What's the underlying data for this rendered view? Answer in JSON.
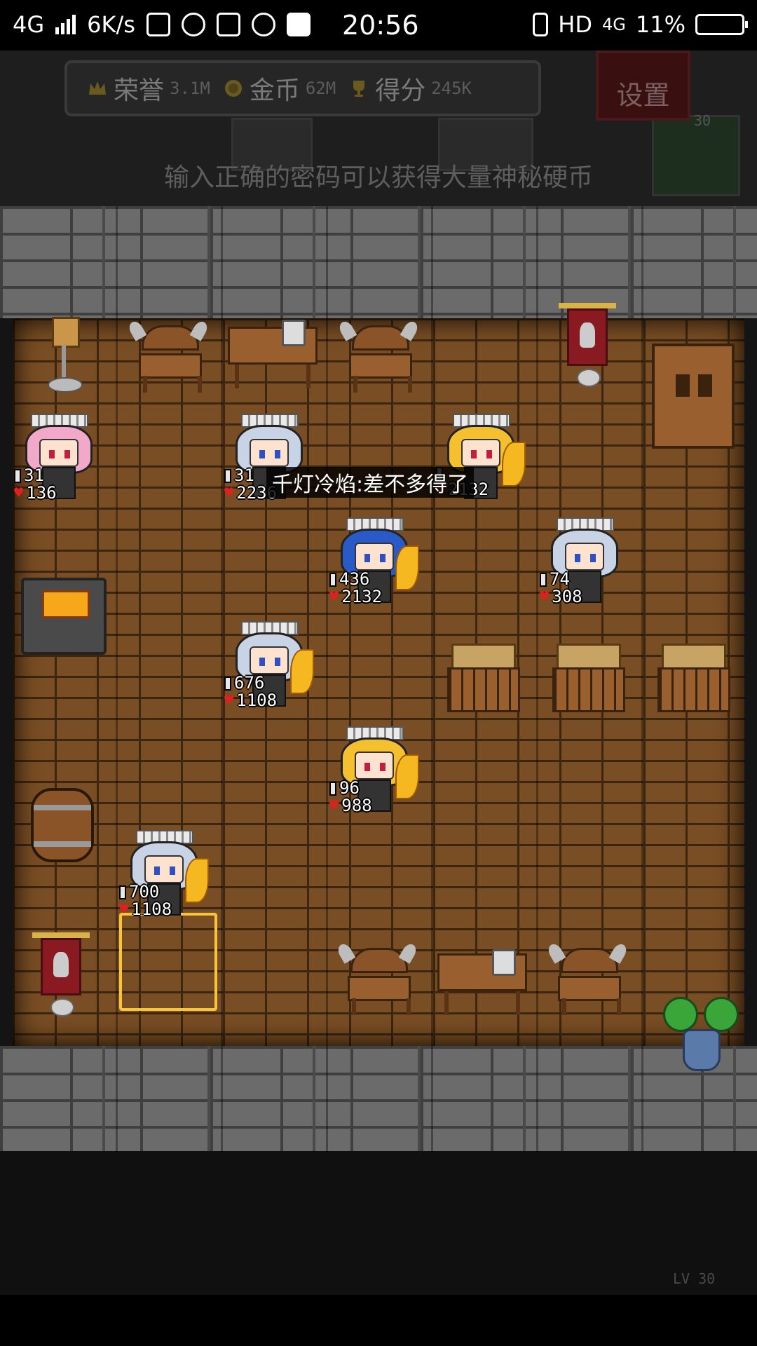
{
  "status_bar": {
    "network": "4G",
    "speed": "6K/s",
    "time": "20:56",
    "hd": "HD",
    "net_right": "4G",
    "battery": "11%"
  },
  "hud": {
    "honor_label": "荣誉",
    "honor_value": "3.1M",
    "gold_label": "金币",
    "gold_value": "62M",
    "score_label": "得分",
    "score_value": "245K",
    "settings_label": "设置",
    "code_hint": "输入正确的密码可以获得大量神秘硬币",
    "level_badge_top": "30",
    "level_badge_bottom": "LV 30"
  },
  "speech_bubble": "千灯冷焰:差不多得了",
  "heroes": [
    {
      "id": "pink",
      "atk": "31",
      "hp": "136",
      "hair": "#f2a8c8"
    },
    {
      "id": "silver-1",
      "atk": "31",
      "hp": "2236",
      "hair": "#c8d4e6"
    },
    {
      "id": "blonde-1",
      "atk": "",
      "hp": "2132",
      "hair": "#f5c030"
    },
    {
      "id": "blue",
      "atk": "436",
      "hp": "2132",
      "hair": "#2a5ac8"
    },
    {
      "id": "silver-2",
      "atk": "74",
      "hp": "308",
      "hair": "#c8d4e6"
    },
    {
      "id": "silver-3",
      "atk": "676",
      "hp": "1108",
      "hair": "#c8d4e6"
    },
    {
      "id": "blonde-2",
      "atk": "96",
      "hp": "988",
      "hair": "#f5c030"
    },
    {
      "id": "silver-4",
      "atk": "700",
      "hp": "1108",
      "hair": "#c8d4e6"
    }
  ],
  "colors": {
    "floor": "#7a4e24",
    "wall": "#6b6b6b",
    "selection": "#f7c43a"
  }
}
